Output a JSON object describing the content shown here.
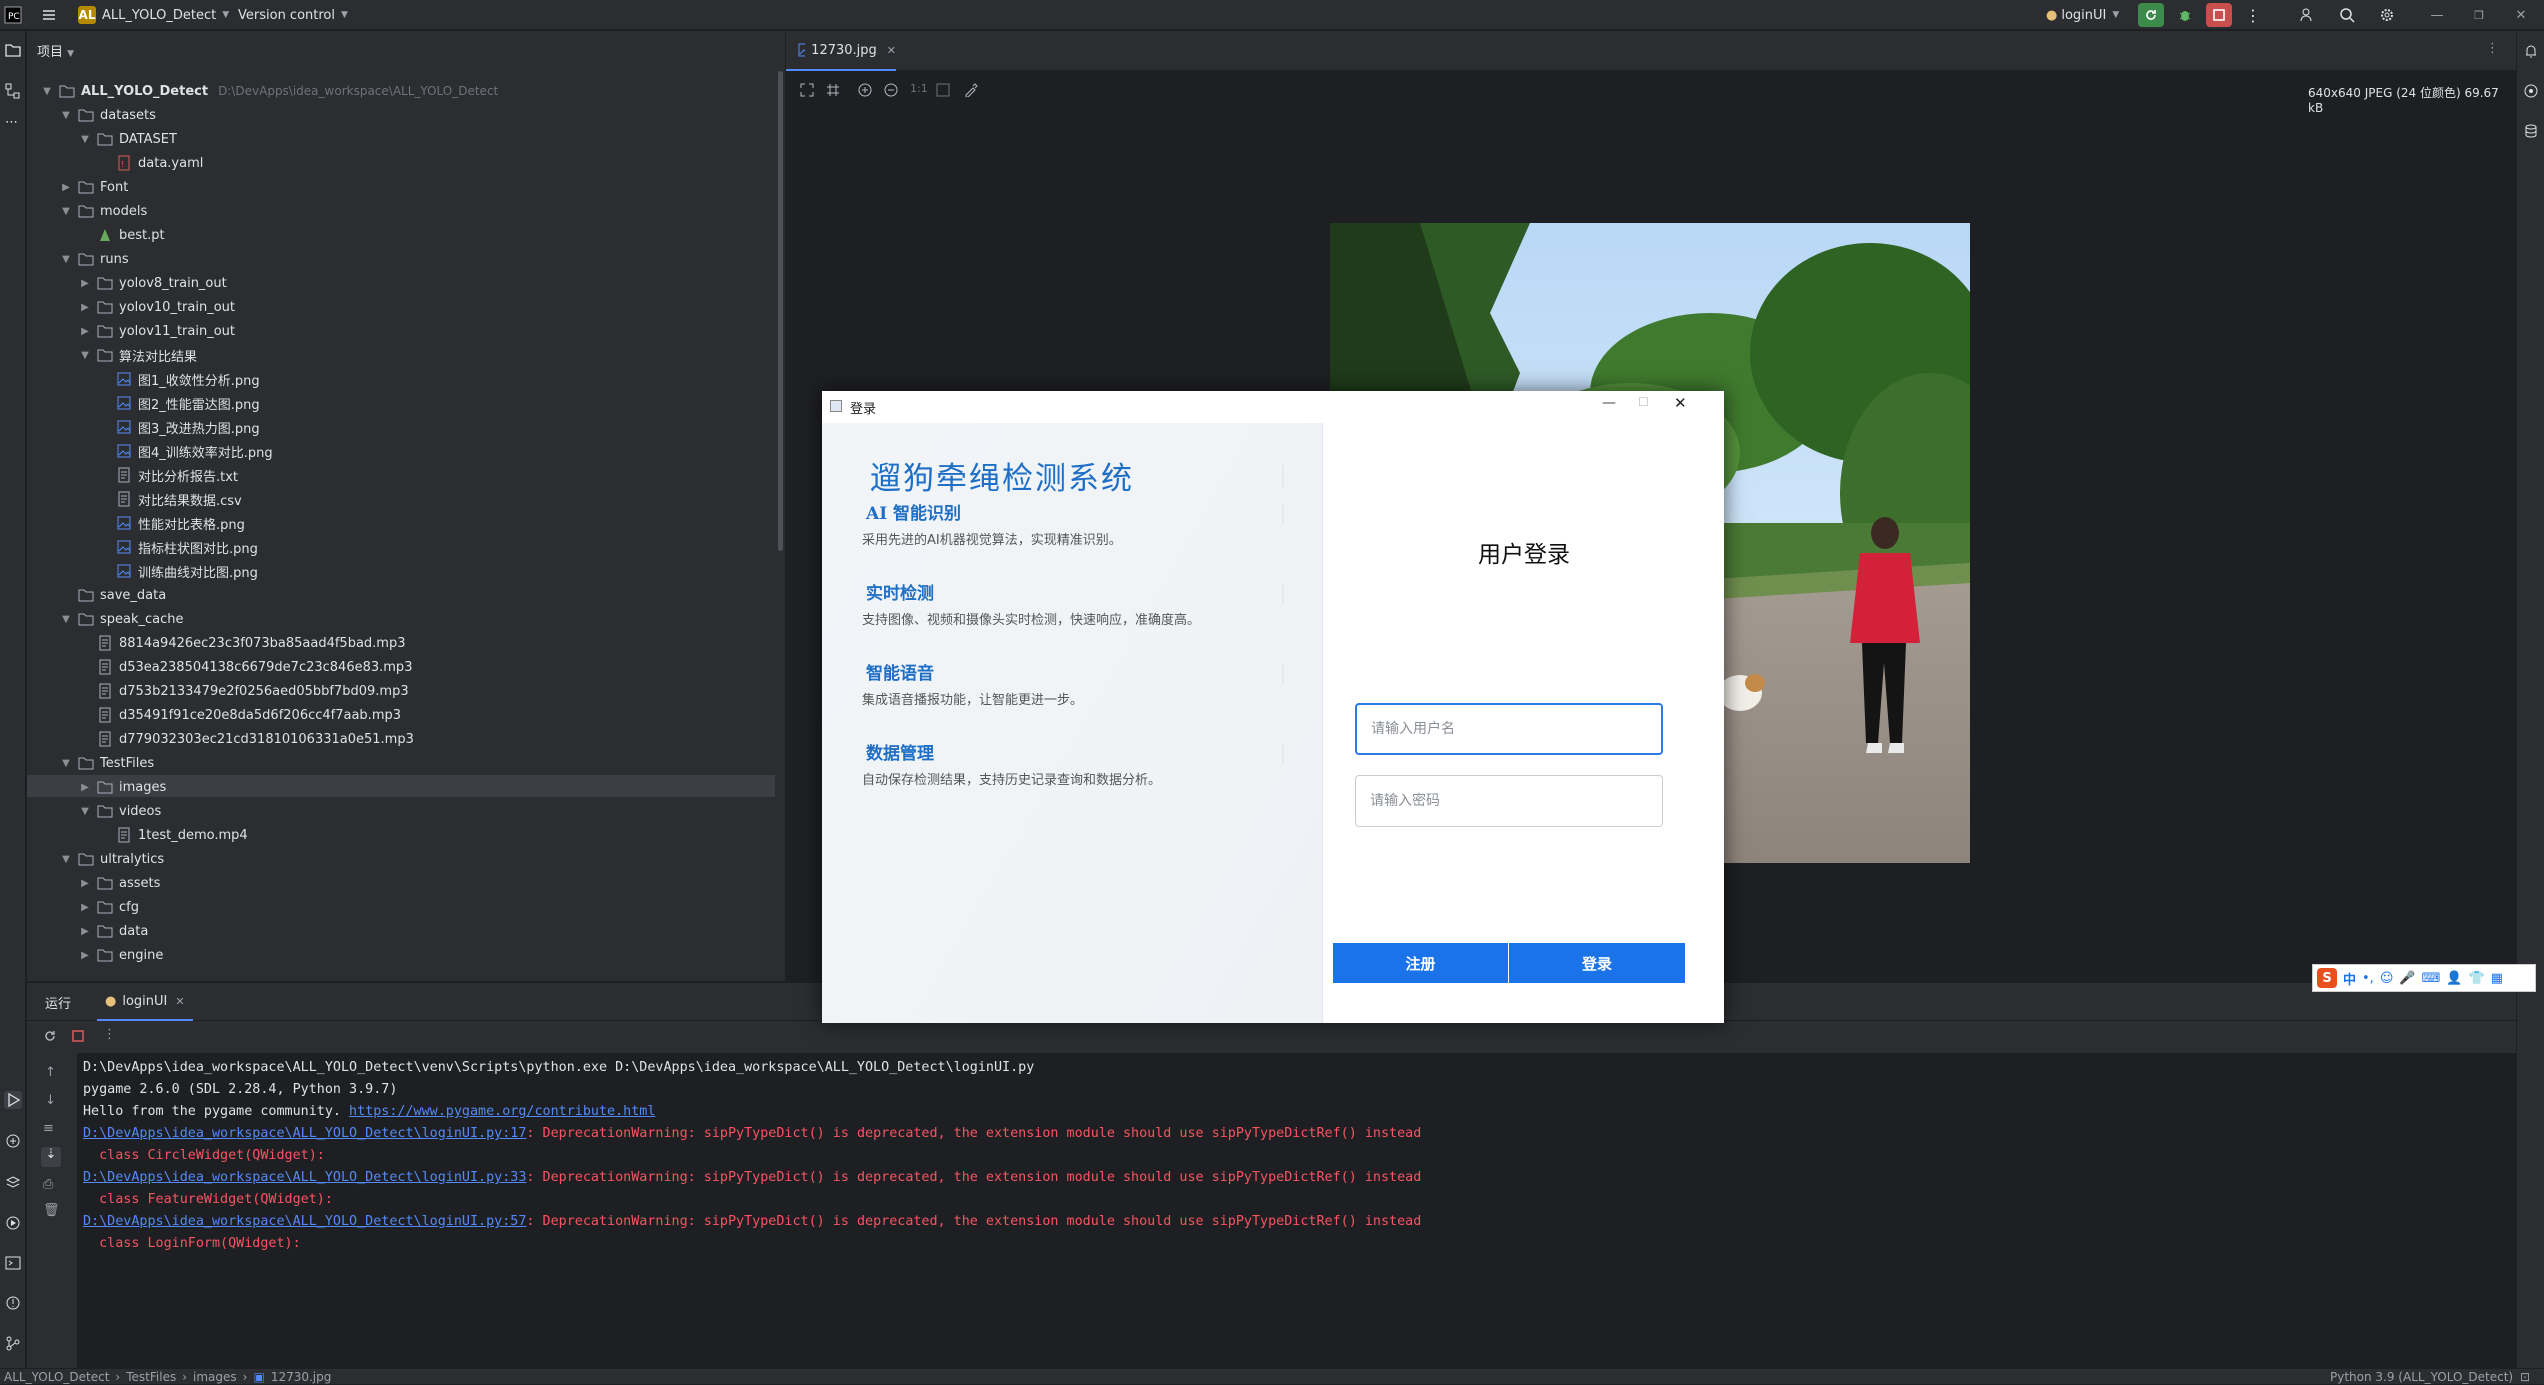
{
  "titlebar": {
    "project_badge": "AL",
    "project_name": "ALL_YOLO_Detect",
    "vcs": "Version control",
    "run_config": "loginUI"
  },
  "project_panel": {
    "title": "项目",
    "root": {
      "name": "ALL_YOLO_Detect",
      "path": "D:\\DevApps\\idea_workspace\\ALL_YOLO_Detect"
    },
    "rows": [
      {
        "label": "datasets",
        "type": "folder",
        "depth": 1,
        "open": true
      },
      {
        "label": "DATASET",
        "type": "folder",
        "depth": 2,
        "open": true
      },
      {
        "label": "data.yaml",
        "type": "yaml",
        "depth": 3
      },
      {
        "label": "Font",
        "type": "folder",
        "depth": 1,
        "open": false
      },
      {
        "label": "models",
        "type": "folder",
        "depth": 1,
        "open": true
      },
      {
        "label": "best.pt",
        "type": "pt",
        "depth": 2
      },
      {
        "label": "runs",
        "type": "folder",
        "depth": 1,
        "open": true
      },
      {
        "label": "yolov8_train_out",
        "type": "folder",
        "depth": 2,
        "open": false
      },
      {
        "label": "yolov10_train_out",
        "type": "folder",
        "depth": 2,
        "open": false
      },
      {
        "label": "yolov11_train_out",
        "type": "folder",
        "depth": 2,
        "open": false
      },
      {
        "label": "算法对比结果",
        "type": "folder",
        "depth": 2,
        "open": true
      },
      {
        "label": "图1_收敛性分析.png",
        "type": "png",
        "depth": 3
      },
      {
        "label": "图2_性能雷达图.png",
        "type": "png",
        "depth": 3
      },
      {
        "label": "图3_改进热力图.png",
        "type": "png",
        "depth": 3
      },
      {
        "label": "图4_训练效率对比.png",
        "type": "png",
        "depth": 3
      },
      {
        "label": "对比分析报告.txt",
        "type": "txt",
        "depth": 3
      },
      {
        "label": "对比结果数据.csv",
        "type": "txt",
        "depth": 3
      },
      {
        "label": "性能对比表格.png",
        "type": "png",
        "depth": 3
      },
      {
        "label": "指标柱状图对比.png",
        "type": "png",
        "depth": 3
      },
      {
        "label": "训练曲线对比图.png",
        "type": "png",
        "depth": 3
      },
      {
        "label": "save_data",
        "type": "folder",
        "depth": 1,
        "open": null
      },
      {
        "label": "speak_cache",
        "type": "folder",
        "depth": 1,
        "open": true
      },
      {
        "label": "8814a9426ec23c3f073ba85aad4f5bad.mp3",
        "type": "txt",
        "depth": 2
      },
      {
        "label": "d53ea238504138c6679de7c23c846e83.mp3",
        "type": "txt",
        "depth": 2
      },
      {
        "label": "d753b2133479e2f0256aed05bbf7bd09.mp3",
        "type": "txt",
        "depth": 2
      },
      {
        "label": "d35491f91ce20e8da5d6f206cc4f7aab.mp3",
        "type": "txt",
        "depth": 2
      },
      {
        "label": "d779032303ec21cd31810106331a0e51.mp3",
        "type": "txt",
        "depth": 2
      },
      {
        "label": "TestFiles",
        "type": "folder",
        "depth": 1,
        "open": true
      },
      {
        "label": "images",
        "type": "folder",
        "depth": 2,
        "open": false,
        "selected": true
      },
      {
        "label": "videos",
        "type": "folder",
        "depth": 2,
        "open": true
      },
      {
        "label": "1test_demo.mp4",
        "type": "txt",
        "depth": 3
      },
      {
        "label": "ultralytics",
        "type": "folder",
        "depth": 1,
        "open": true
      },
      {
        "label": "assets",
        "type": "folder",
        "depth": 2,
        "open": false
      },
      {
        "label": "cfg",
        "type": "folder",
        "depth": 2,
        "open": false
      },
      {
        "label": "data",
        "type": "folder",
        "depth": 2,
        "open": false
      },
      {
        "label": "engine",
        "type": "folder",
        "depth": 2,
        "open": false
      }
    ]
  },
  "editor": {
    "tab_label": "12730.jpg",
    "zoom_label": "1:1",
    "image_info": "640x640 JPEG (24 位颜色) 69.67 kB"
  },
  "run_panel": {
    "title": "运行",
    "tab_label": "loginUI",
    "lines": [
      {
        "kind": "normal",
        "text": "D:\\DevApps\\idea_workspace\\ALL_YOLO_Detect\\venv\\Scripts\\python.exe D:\\DevApps\\idea_workspace\\ALL_YOLO_Detect\\loginUI.py"
      },
      {
        "kind": "normal",
        "text": "pygame 2.6.0 (SDL 2.28.4, Python 3.9.7)"
      },
      {
        "kind": "link",
        "prefix": "Hello from the pygame community. ",
        "link": "https://www.pygame.org/contribute.html"
      },
      {
        "kind": "warn",
        "link": "D:\\DevApps\\idea_workspace\\ALL_YOLO_Detect\\loginUI.py:17",
        "text": ": DeprecationWarning: sipPyTypeDict() is deprecated, the extension module should use sipPyTypeDictRef() instead"
      },
      {
        "kind": "err",
        "text": "  class CircleWidget(QWidget):"
      },
      {
        "kind": "warn",
        "link": "D:\\DevApps\\idea_workspace\\ALL_YOLO_Detect\\loginUI.py:33",
        "text": ": DeprecationWarning: sipPyTypeDict() is deprecated, the extension module should use sipPyTypeDictRef() instead"
      },
      {
        "kind": "err",
        "text": "  class FeatureWidget(QWidget):"
      },
      {
        "kind": "warn",
        "link": "D:\\DevApps\\idea_workspace\\ALL_YOLO_Detect\\loginUI.py:57",
        "text": ": DeprecationWarning: sipPyTypeDict() is deprecated, the extension module should use sipPyTypeDictRef() instead"
      },
      {
        "kind": "err",
        "text": "  class LoginForm(QWidget):"
      }
    ]
  },
  "login_window": {
    "title": "登录",
    "app_title": "遛狗牵绳检测系统",
    "features": [
      {
        "title": "AI 智能识别",
        "desc": "采用先进的AI机器视觉算法，实现精准识别。"
      },
      {
        "title": "实时检测",
        "desc": "支持图像、视频和摄像头实时检测，快速响应，准确度高。"
      },
      {
        "title": "智能语音",
        "desc": "集成语音播报功能，让智能更进一步。"
      },
      {
        "title": "数据管理",
        "desc": "自动保存检测结果，支持历史记录查询和数据分析。"
      }
    ],
    "form_title": "用户登录",
    "username_placeholder": "请输入用户名",
    "password_placeholder": "请输入密码",
    "register_label": "注册",
    "login_label": "登录"
  },
  "ime": {
    "lang": "中"
  },
  "status_bar": {
    "breadcrumb": [
      "ALL_YOLO_Detect",
      "TestFiles",
      "images",
      "12730.jpg"
    ],
    "interpreter": "Python 3.9 (ALL_YOLO_Detect)"
  },
  "colors": {
    "accent": "#1a73e8",
    "title_blue": "#1f6fc7",
    "ide_bg": "#1e1f22",
    "panel_bg": "#2b2d30",
    "error_red": "#f75464",
    "link_blue": "#548af7"
  }
}
